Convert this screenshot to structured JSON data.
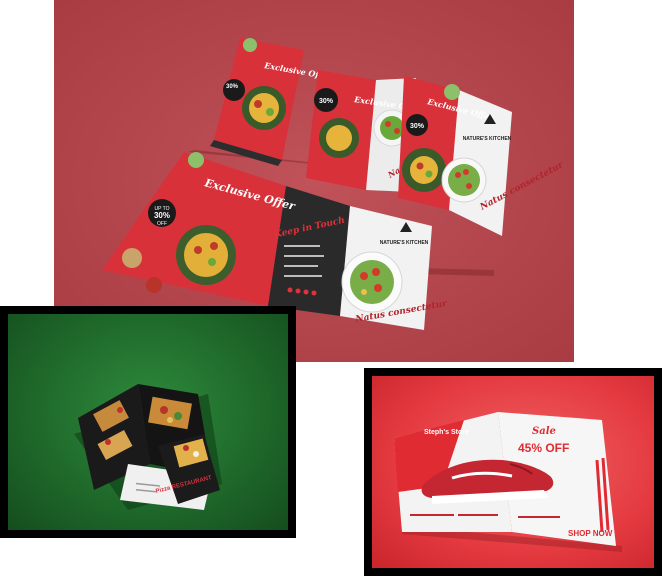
{
  "panels": {
    "restaurant_brochures": {
      "accent": "#b7464b",
      "headline": "Exclusive Offer",
      "discount_prefix": "UP TO",
      "discount_value": "30%",
      "discount_suffix": "OFF",
      "brand": "NATURE'S KITCHEN",
      "tagline": "Keep in Touch",
      "script": "Natus consectetur"
    },
    "pizza_brochure": {
      "accent": "#1f6a2b",
      "brand": "Pizza RESTAURANT"
    },
    "shoe_flyer": {
      "accent": "#e43a40",
      "store": "Steph's Store",
      "sale": "Sale",
      "offer": "45% OFF",
      "cta": "SHOP NOW"
    }
  }
}
